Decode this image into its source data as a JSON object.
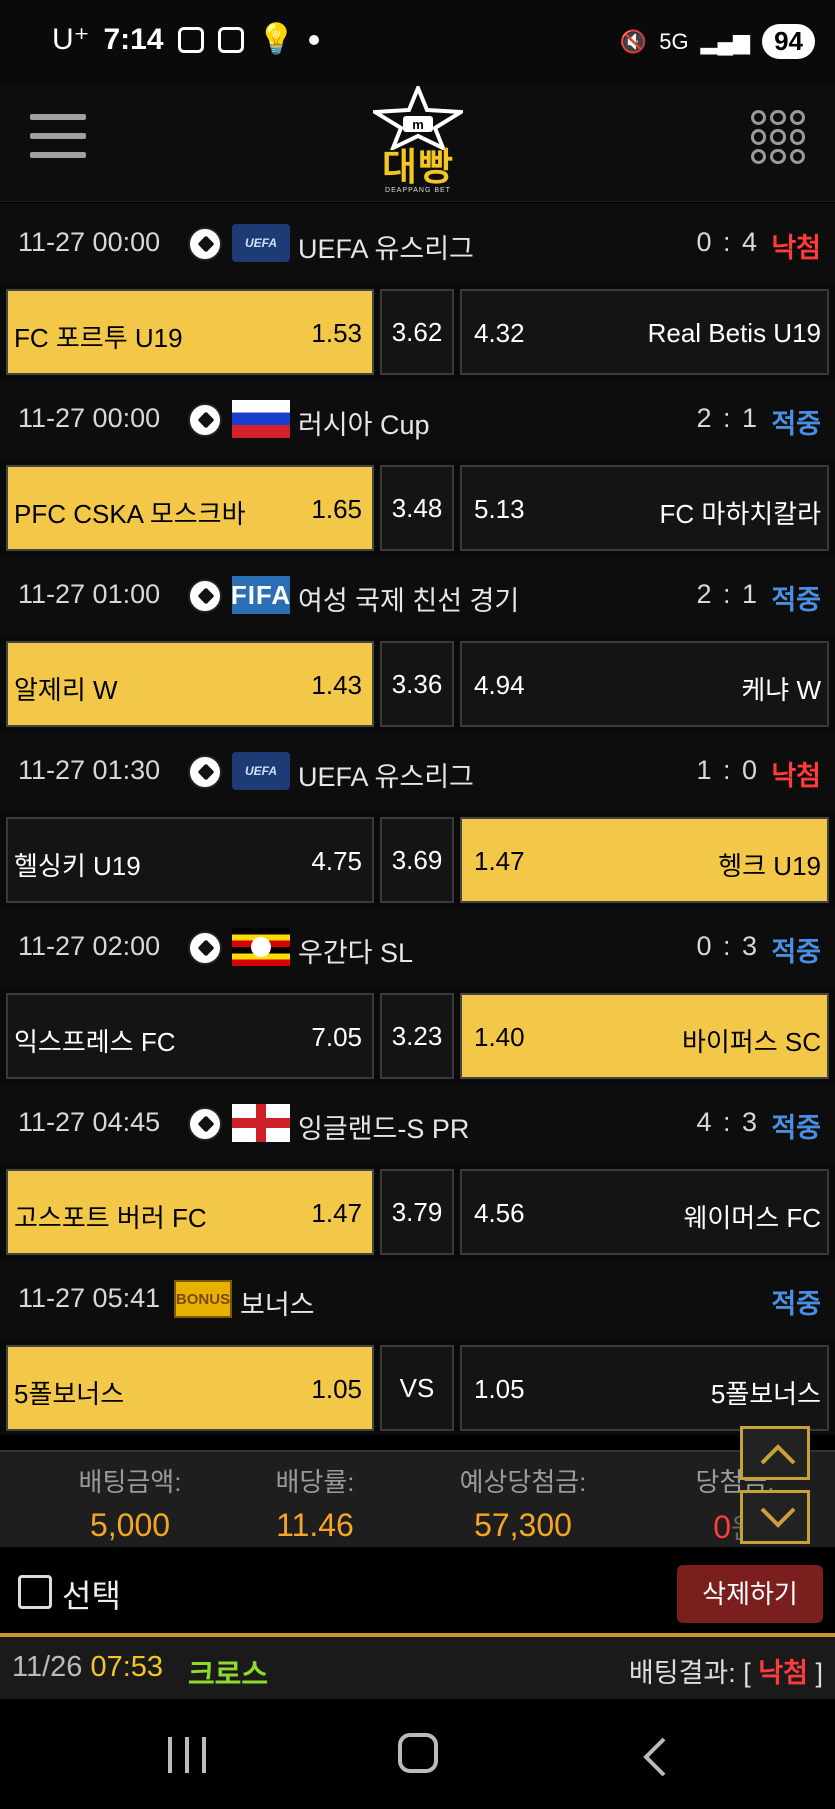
{
  "status_bar": {
    "carrier": "U⁺",
    "time": "7:14",
    "network": "5G",
    "battery": "94"
  },
  "header": {
    "logo_text": "대빵",
    "logo_sub": "DEAPPANG BET"
  },
  "matches": [
    {
      "date": "11-27 00:00",
      "flag": "uefa-flag-icon",
      "league": "UEFA 유스리그",
      "score": "0 : 4",
      "result": "낙첨",
      "result_status": "lose",
      "home": "FC 포르투 U19",
      "home_odd": "1.53",
      "draw": "3.62",
      "away_odd": "4.32",
      "away": "Real Betis U19",
      "selected": "home"
    },
    {
      "date": "11-27 00:00",
      "flag": "russia-flag-icon",
      "league": "러시아 Cup",
      "score": "2 : 1",
      "result": "적중",
      "result_status": "win",
      "home": "PFC CSKA 모스크바",
      "home_odd": "1.65",
      "draw": "3.48",
      "away_odd": "5.13",
      "away": "FC 마하치칼라",
      "selected": "home"
    },
    {
      "date": "11-27 01:00",
      "flag": "fifa-flag-icon",
      "league": "여성 국제 친선 경기",
      "score": "2 : 1",
      "result": "적중",
      "result_status": "win",
      "home": "알제리 W",
      "home_odd": "1.43",
      "draw": "3.36",
      "away_odd": "4.94",
      "away": "케냐 W",
      "selected": "home"
    },
    {
      "date": "11-27 01:30",
      "flag": "uefa-flag-icon",
      "league": "UEFA 유스리그",
      "score": "1 : 0",
      "result": "낙첨",
      "result_status": "lose",
      "home": "헬싱키 U19",
      "home_odd": "4.75",
      "draw": "3.69",
      "away_odd": "1.47",
      "away": "헹크 U19",
      "selected": "away"
    },
    {
      "date": "11-27 02:00",
      "flag": "uganda-flag-icon",
      "league": "우간다 SL",
      "score": "0 : 3",
      "result": "적중",
      "result_status": "win",
      "home": "익스프레스 FC",
      "home_odd": "7.05",
      "draw": "3.23",
      "away_odd": "1.40",
      "away": "바이퍼스 SC",
      "selected": "away"
    },
    {
      "date": "11-27 04:45",
      "flag": "england-flag-icon",
      "league": "잉글랜드-S PR",
      "score": "4 : 3",
      "result": "적중",
      "result_status": "win",
      "home": "고스포트 버러 FC",
      "home_odd": "1.47",
      "draw": "3.79",
      "away_odd": "4.56",
      "away": "웨이머스 FC",
      "selected": "home"
    },
    {
      "date": "11-27 05:41",
      "flag": "bonus-badge-icon",
      "flag_text": "BONUS",
      "league": "보너스",
      "score": "",
      "result": "적중",
      "result_status": "win",
      "home": "5폴보너스",
      "home_odd": "1.05",
      "draw": "VS",
      "away_odd": "1.05",
      "away": "5폴보너스",
      "selected": "home"
    }
  ],
  "summary": {
    "bet_amount_label": "배팅금액:",
    "bet_amount": "5,000",
    "odds_label": "배당률:",
    "odds": "11.46",
    "expected_label": "예상당첨금:",
    "expected": "57,300",
    "win_label": "당첨금:",
    "win_amount": "0",
    "win_unit": "원"
  },
  "actions": {
    "select_label": "선택",
    "delete_label": "삭제하기"
  },
  "bet_footer": {
    "date": "11/26",
    "time": "07:53",
    "type": "크로스",
    "result_label": "배팅결과: [",
    "result": "낙첨",
    "result_close": "]"
  },
  "colors": {
    "selected": "#f3c748",
    "win": "#4a90e2",
    "lose": "#ff3b3b",
    "amount": "#f5a623"
  }
}
